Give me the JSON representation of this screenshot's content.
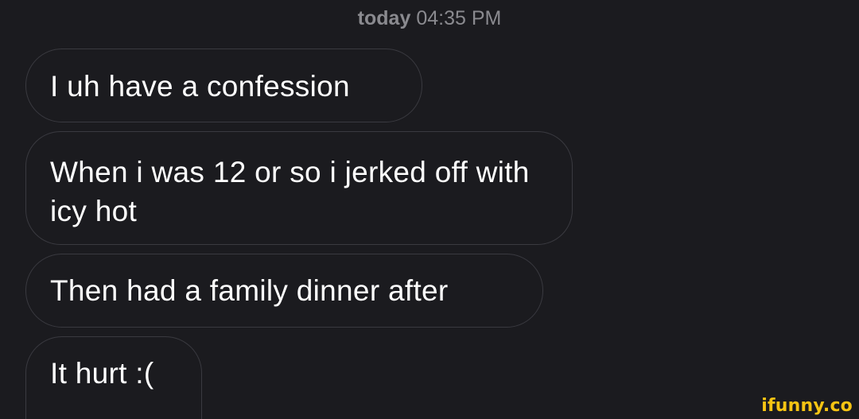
{
  "header": {
    "day": "today",
    "time": "04:35 PM"
  },
  "messages": [
    {
      "text": "I uh have a confession"
    },
    {
      "text": "When i was 12 or so i jerked off with icy hot"
    },
    {
      "text": "Then had a family dinner after"
    },
    {
      "text": "It hurt :("
    }
  ],
  "watermark": {
    "text": "ifunny.co"
  },
  "colors": {
    "background": "#1b1b1f",
    "bubble_border": "#3a3a40",
    "message_text": "#ffffff",
    "timestamp_text": "#8a8a8f",
    "watermark": "#f6c413"
  }
}
